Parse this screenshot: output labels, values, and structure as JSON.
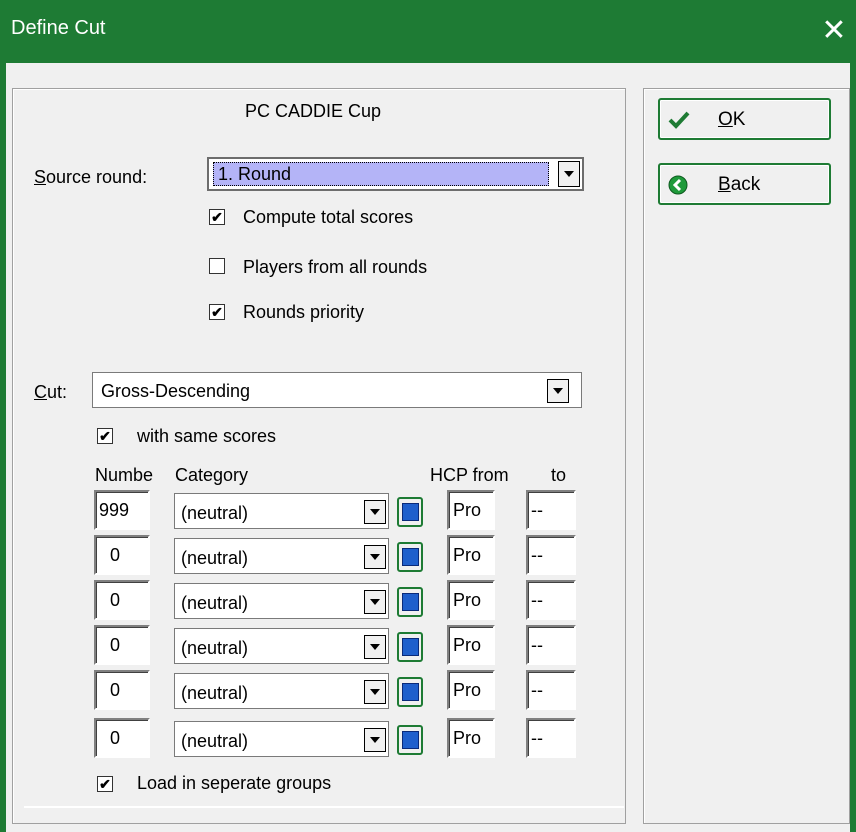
{
  "window": {
    "title": "Define Cut",
    "close_glyph": "✕"
  },
  "header": {
    "tournament": "PC CADDIE Cup"
  },
  "source_round": {
    "label_prefix": "",
    "label_underlined": "S",
    "label_rest": "ource round:",
    "selected": "1. Round"
  },
  "options": [
    {
      "label": "Compute total scores",
      "checked": true
    },
    {
      "label": "Players from all rounds",
      "checked": false
    },
    {
      "label": "Rounds priority",
      "checked": true
    }
  ],
  "cut": {
    "label_underlined": "C",
    "label_rest": "ut:",
    "selected": "Gross-Descending"
  },
  "same_scores": {
    "label": "with same scores",
    "checked": true
  },
  "columns": {
    "number": "Numbe",
    "category": "Category",
    "hcp_from": "HCP from",
    "to": "to"
  },
  "rows": [
    {
      "number": "999",
      "category": "(neutral)",
      "hcp_from": "Pro",
      "to": "--"
    },
    {
      "number": "0",
      "category": "(neutral)",
      "hcp_from": "Pro",
      "to": "--"
    },
    {
      "number": "0",
      "category": "(neutral)",
      "hcp_from": "Pro",
      "to": "--"
    },
    {
      "number": "0",
      "category": "(neutral)",
      "hcp_from": "Pro",
      "to": "--"
    },
    {
      "number": "0",
      "category": "(neutral)",
      "hcp_from": "Pro",
      "to": "--"
    },
    {
      "number": "0",
      "category": "(neutral)",
      "hcp_from": "Pro",
      "to": "--"
    }
  ],
  "separate_groups": {
    "label": "Load in seperate groups",
    "checked": true
  },
  "buttons": {
    "ok": {
      "underlined": "O",
      "rest": "K",
      "icon": "checkmark-icon"
    },
    "back": {
      "underlined": "B",
      "rest": "ack",
      "icon": "back-arrow-icon"
    }
  },
  "colors": {
    "titlebar": "#1e7b34",
    "selection": "#b4b4f7",
    "accent_blue": "#1f5fcc"
  },
  "check_glyph": "✔"
}
